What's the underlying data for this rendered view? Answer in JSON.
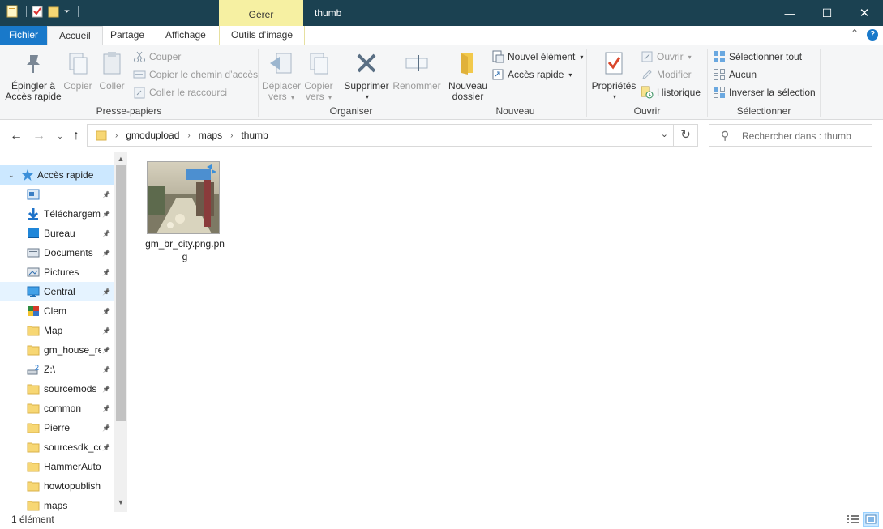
{
  "window": {
    "title": "thumb",
    "context_tab": "Gérer",
    "controls": {
      "minimize": "—",
      "maximize": "☐",
      "close": "✕"
    }
  },
  "ribbon_tabs": {
    "fichier": "Fichier",
    "accueil": "Accueil",
    "partage": "Partage",
    "affichage": "Affichage",
    "outils_image": "Outils d’image"
  },
  "ribbon": {
    "presse_papiers": {
      "label": "Presse-papiers",
      "pin_line1": "Épingler à",
      "pin_line2": "Accès rapide",
      "copy": "Copier",
      "paste": "Coller",
      "cut": "Couper",
      "copy_path": "Copier le chemin d’accès",
      "paste_shortcut": "Coller le raccourci"
    },
    "organiser": {
      "label": "Organiser",
      "move_line1": "Déplacer",
      "move_line2": "vers",
      "copy_line1": "Copier",
      "copy_line2": "vers",
      "delete": "Supprimer",
      "rename": "Renommer"
    },
    "nouveau": {
      "label": "Nouveau",
      "new_folder_line1": "Nouveau",
      "new_folder_line2": "dossier",
      "new_item": "Nouvel élément",
      "easy_access": "Accès rapide"
    },
    "ouvrir": {
      "label": "Ouvrir",
      "properties": "Propriétés",
      "open": "Ouvrir",
      "edit": "Modifier",
      "history": "Historique"
    },
    "selectionner": {
      "label": "Sélectionner",
      "select_all": "Sélectionner tout",
      "select_none": "Aucun",
      "invert": "Inverser la sélection"
    }
  },
  "address": {
    "crumbs": [
      "gmodupload",
      "maps",
      "thumb"
    ],
    "search_placeholder": "Rechercher dans : thumb"
  },
  "nav": {
    "quick_access": "Accès rapide",
    "items": [
      {
        "label": "",
        "icon": "image-library-icon"
      },
      {
        "label": "Téléchargements",
        "icon": "downloads-icon"
      },
      {
        "label": "Bureau",
        "icon": "desktop-icon"
      },
      {
        "label": "Documents",
        "icon": "documents-icon"
      },
      {
        "label": "Pictures",
        "icon": "pictures-icon"
      },
      {
        "label": "Central",
        "icon": "monitor-icon"
      },
      {
        "label": "Clem",
        "icon": "colored-folder-icon"
      },
      {
        "label": "Map",
        "icon": "folder-icon"
      },
      {
        "label": "gm_house_re",
        "icon": "folder-icon"
      },
      {
        "label": "Z:\\",
        "icon": "network-drive-icon"
      },
      {
        "label": "sourcemods",
        "icon": "folder-icon"
      },
      {
        "label": "common",
        "icon": "folder-icon"
      },
      {
        "label": "Pierre",
        "icon": "folder-icon"
      },
      {
        "label": "sourcesdk_co",
        "icon": "folder-icon"
      },
      {
        "label": "HammerAutosav",
        "icon": "folder-icon"
      },
      {
        "label": "howtopublishan",
        "icon": "folder-icon"
      },
      {
        "label": "maps",
        "icon": "folder-icon"
      }
    ]
  },
  "files": [
    {
      "name": "gm_br_city.png.png"
    }
  ],
  "status": {
    "count": "1 élément"
  },
  "colors": {
    "titlebar": "#1b4151",
    "context_tab": "#f6f0a2",
    "file_tab": "#1979ca",
    "selection": "#cce8ff"
  }
}
